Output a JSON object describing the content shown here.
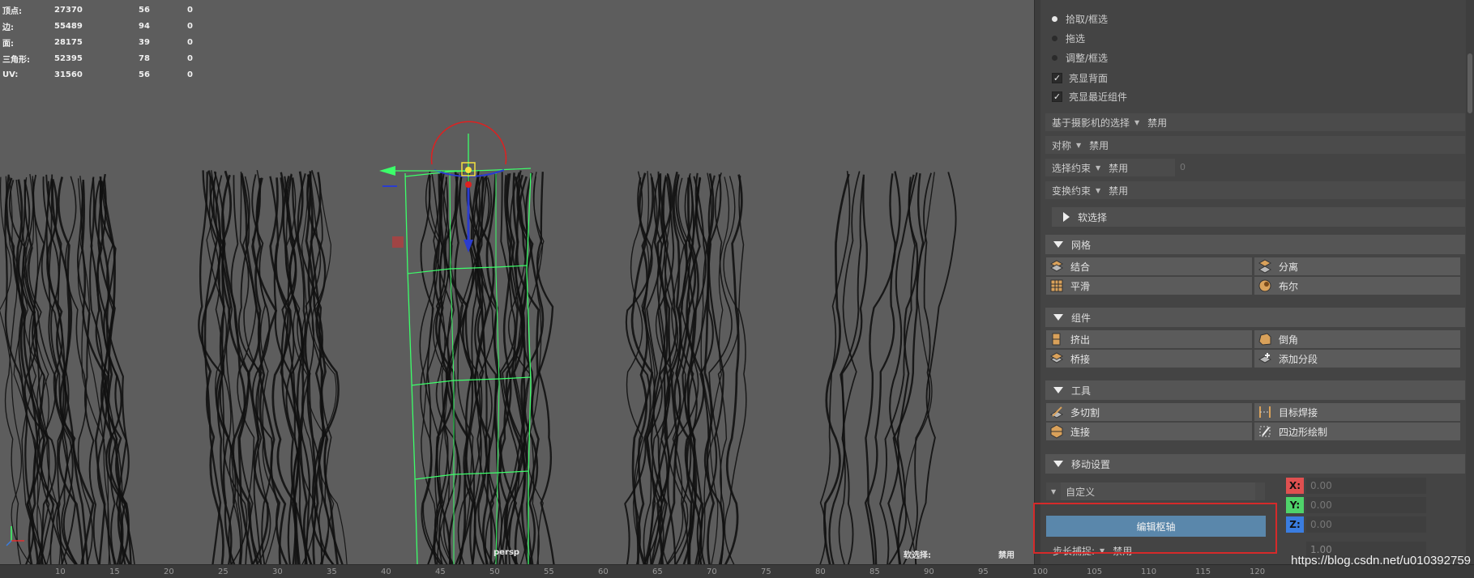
{
  "hud": {
    "rows": [
      {
        "label": "顶点:",
        "v1": "27370",
        "v2": "56",
        "v3": "0"
      },
      {
        "label": "边:",
        "v1": "55489",
        "v2": "94",
        "v3": "0"
      },
      {
        "label": "面:",
        "v1": "28175",
        "v2": "39",
        "v3": "0"
      },
      {
        "label": "三角形:",
        "v1": "52395",
        "v2": "78",
        "v3": "0"
      },
      {
        "label": "UV:",
        "v1": "31560",
        "v2": "56",
        "v3": "0"
      }
    ]
  },
  "viewport": {
    "camera_label": "persp",
    "soft_select_label": "软选择:",
    "soft_select_value": "禁用"
  },
  "timeline": {
    "ticks": [
      "10",
      "15",
      "20",
      "25",
      "30",
      "35",
      "40",
      "45",
      "50",
      "55",
      "60",
      "65",
      "70",
      "75",
      "80",
      "85",
      "90",
      "95",
      "100",
      "105",
      "110",
      "115",
      "120"
    ]
  },
  "watermark": "https://blog.csdn.net/u010392759",
  "panel": {
    "pick_modes": [
      {
        "label": "拾取/框选",
        "selected": true
      },
      {
        "label": "拖选",
        "selected": false
      },
      {
        "label": "调整/框选",
        "selected": false
      }
    ],
    "checkboxes": [
      {
        "label": "亮显背面",
        "checked": true
      },
      {
        "label": "亮显最近组件",
        "checked": true
      }
    ],
    "camera_select": {
      "label": "基于摄影机的选择",
      "value": "禁用"
    },
    "symmetry": {
      "label": "对称",
      "value": "禁用"
    },
    "select_constraint": {
      "label": "选择约束",
      "value": "禁用",
      "num": "0"
    },
    "transform_constraint": {
      "label": "变换约束",
      "value": "禁用"
    },
    "soft_select_section": "软选择",
    "mesh_section": "网格",
    "mesh_tools": [
      "结合",
      "分离",
      "平滑",
      "布尔"
    ],
    "component_section": "组件",
    "component_tools": [
      "挤出",
      "倒角",
      "桥接",
      "添加分段"
    ],
    "tools_section": "工具",
    "tools_tools": [
      "多切割",
      "目标焊接",
      "连接",
      "四边形绘制"
    ],
    "move_section": "移动设置",
    "move_mode": "自定义",
    "edit_pivot": "编辑枢轴",
    "step_snap": {
      "label": "步长捕捉:",
      "value": "禁用",
      "num": "1.00"
    },
    "axes": [
      {
        "tag": "X:",
        "value": "0.00",
        "color": "#e05050"
      },
      {
        "tag": "Y:",
        "value": "0.00",
        "color": "#4fd36a"
      },
      {
        "tag": "Z:",
        "value": "0.00",
        "color": "#3a7de0"
      }
    ]
  }
}
